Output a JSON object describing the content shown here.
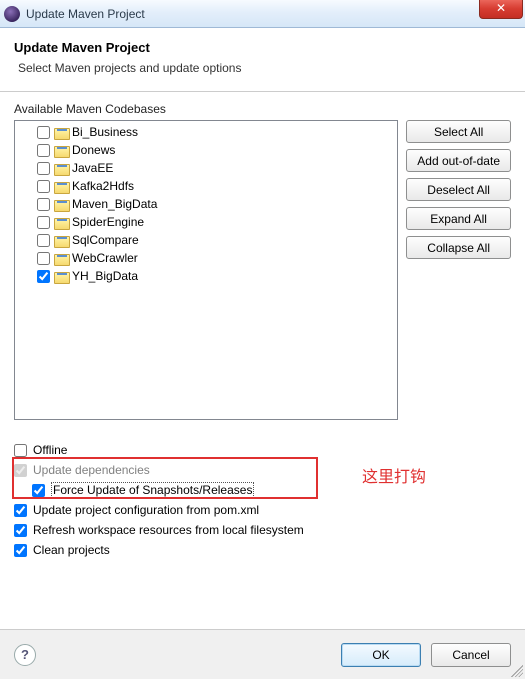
{
  "window": {
    "title": "Update Maven Project"
  },
  "header": {
    "title": "Update Maven Project",
    "subtitle": "Select Maven projects and update options"
  },
  "tree": {
    "label": "Available Maven Codebases",
    "items": [
      {
        "label": "Bi_Business",
        "checked": false
      },
      {
        "label": "Donews",
        "checked": false
      },
      {
        "label": "JavaEE",
        "checked": false
      },
      {
        "label": "Kafka2Hdfs",
        "checked": false
      },
      {
        "label": "Maven_BigData",
        "checked": false
      },
      {
        "label": "SpiderEngine",
        "checked": false
      },
      {
        "label": "SqlCompare",
        "checked": false
      },
      {
        "label": "WebCrawler",
        "checked": false
      },
      {
        "label": "YH_BigData",
        "checked": true
      }
    ]
  },
  "buttons": {
    "select_all": "Select All",
    "add_out_of_date": "Add out-of-date",
    "deselect_all": "Deselect All",
    "expand_all": "Expand All",
    "collapse_all": "Collapse All"
  },
  "options": {
    "offline": {
      "label": "Offline",
      "checked": false
    },
    "update_deps": {
      "label": "Update dependencies",
      "checked": true,
      "disabled": true
    },
    "force_update": {
      "label": "Force Update of Snapshots/Releases",
      "checked": true
    },
    "update_config": {
      "label": "Update project configuration from pom.xml",
      "checked": true
    },
    "refresh_ws": {
      "label": "Refresh workspace resources from local filesystem",
      "checked": true
    },
    "clean": {
      "label": "Clean projects",
      "checked": true
    }
  },
  "annotation": "这里打钩",
  "footer": {
    "ok": "OK",
    "cancel": "Cancel"
  }
}
